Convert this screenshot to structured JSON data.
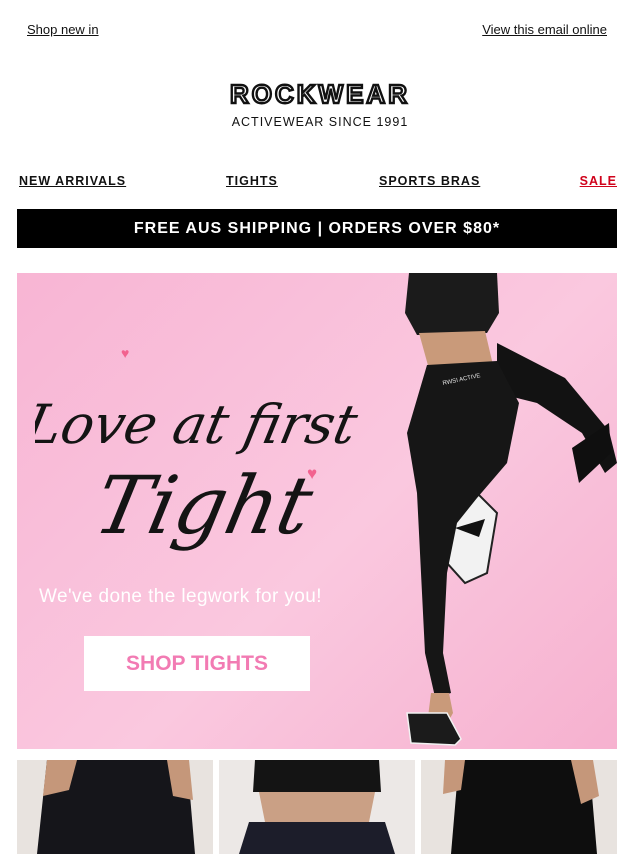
{
  "preheader": {
    "left_link": "Shop new in",
    "right_link": "View this email online"
  },
  "logo": {
    "brand": "ROCKWEAR",
    "tagline": "ACTIVEWEAR SINCE 1991"
  },
  "nav": {
    "items": [
      {
        "label": "NEW ARRIVALS"
      },
      {
        "label": "TIGHTS"
      },
      {
        "label": "SPORTS BRAS"
      },
      {
        "label": "SALE"
      }
    ]
  },
  "banner": {
    "text": "FREE AUS SHIPPING | ORDERS OVER $80*"
  },
  "hero": {
    "headline_line1": "Love at first",
    "headline_line2": "Tight",
    "subtitle": "We've done the legwork for you!",
    "cta": "SHOP TIGHTS",
    "waistband_text": "RWSI ACTIVE"
  },
  "colors": {
    "hero_pink": "#f8b5d4",
    "cta_text": "#f27bb3",
    "sale_red": "#d0021b",
    "banner_bg": "#000000"
  }
}
